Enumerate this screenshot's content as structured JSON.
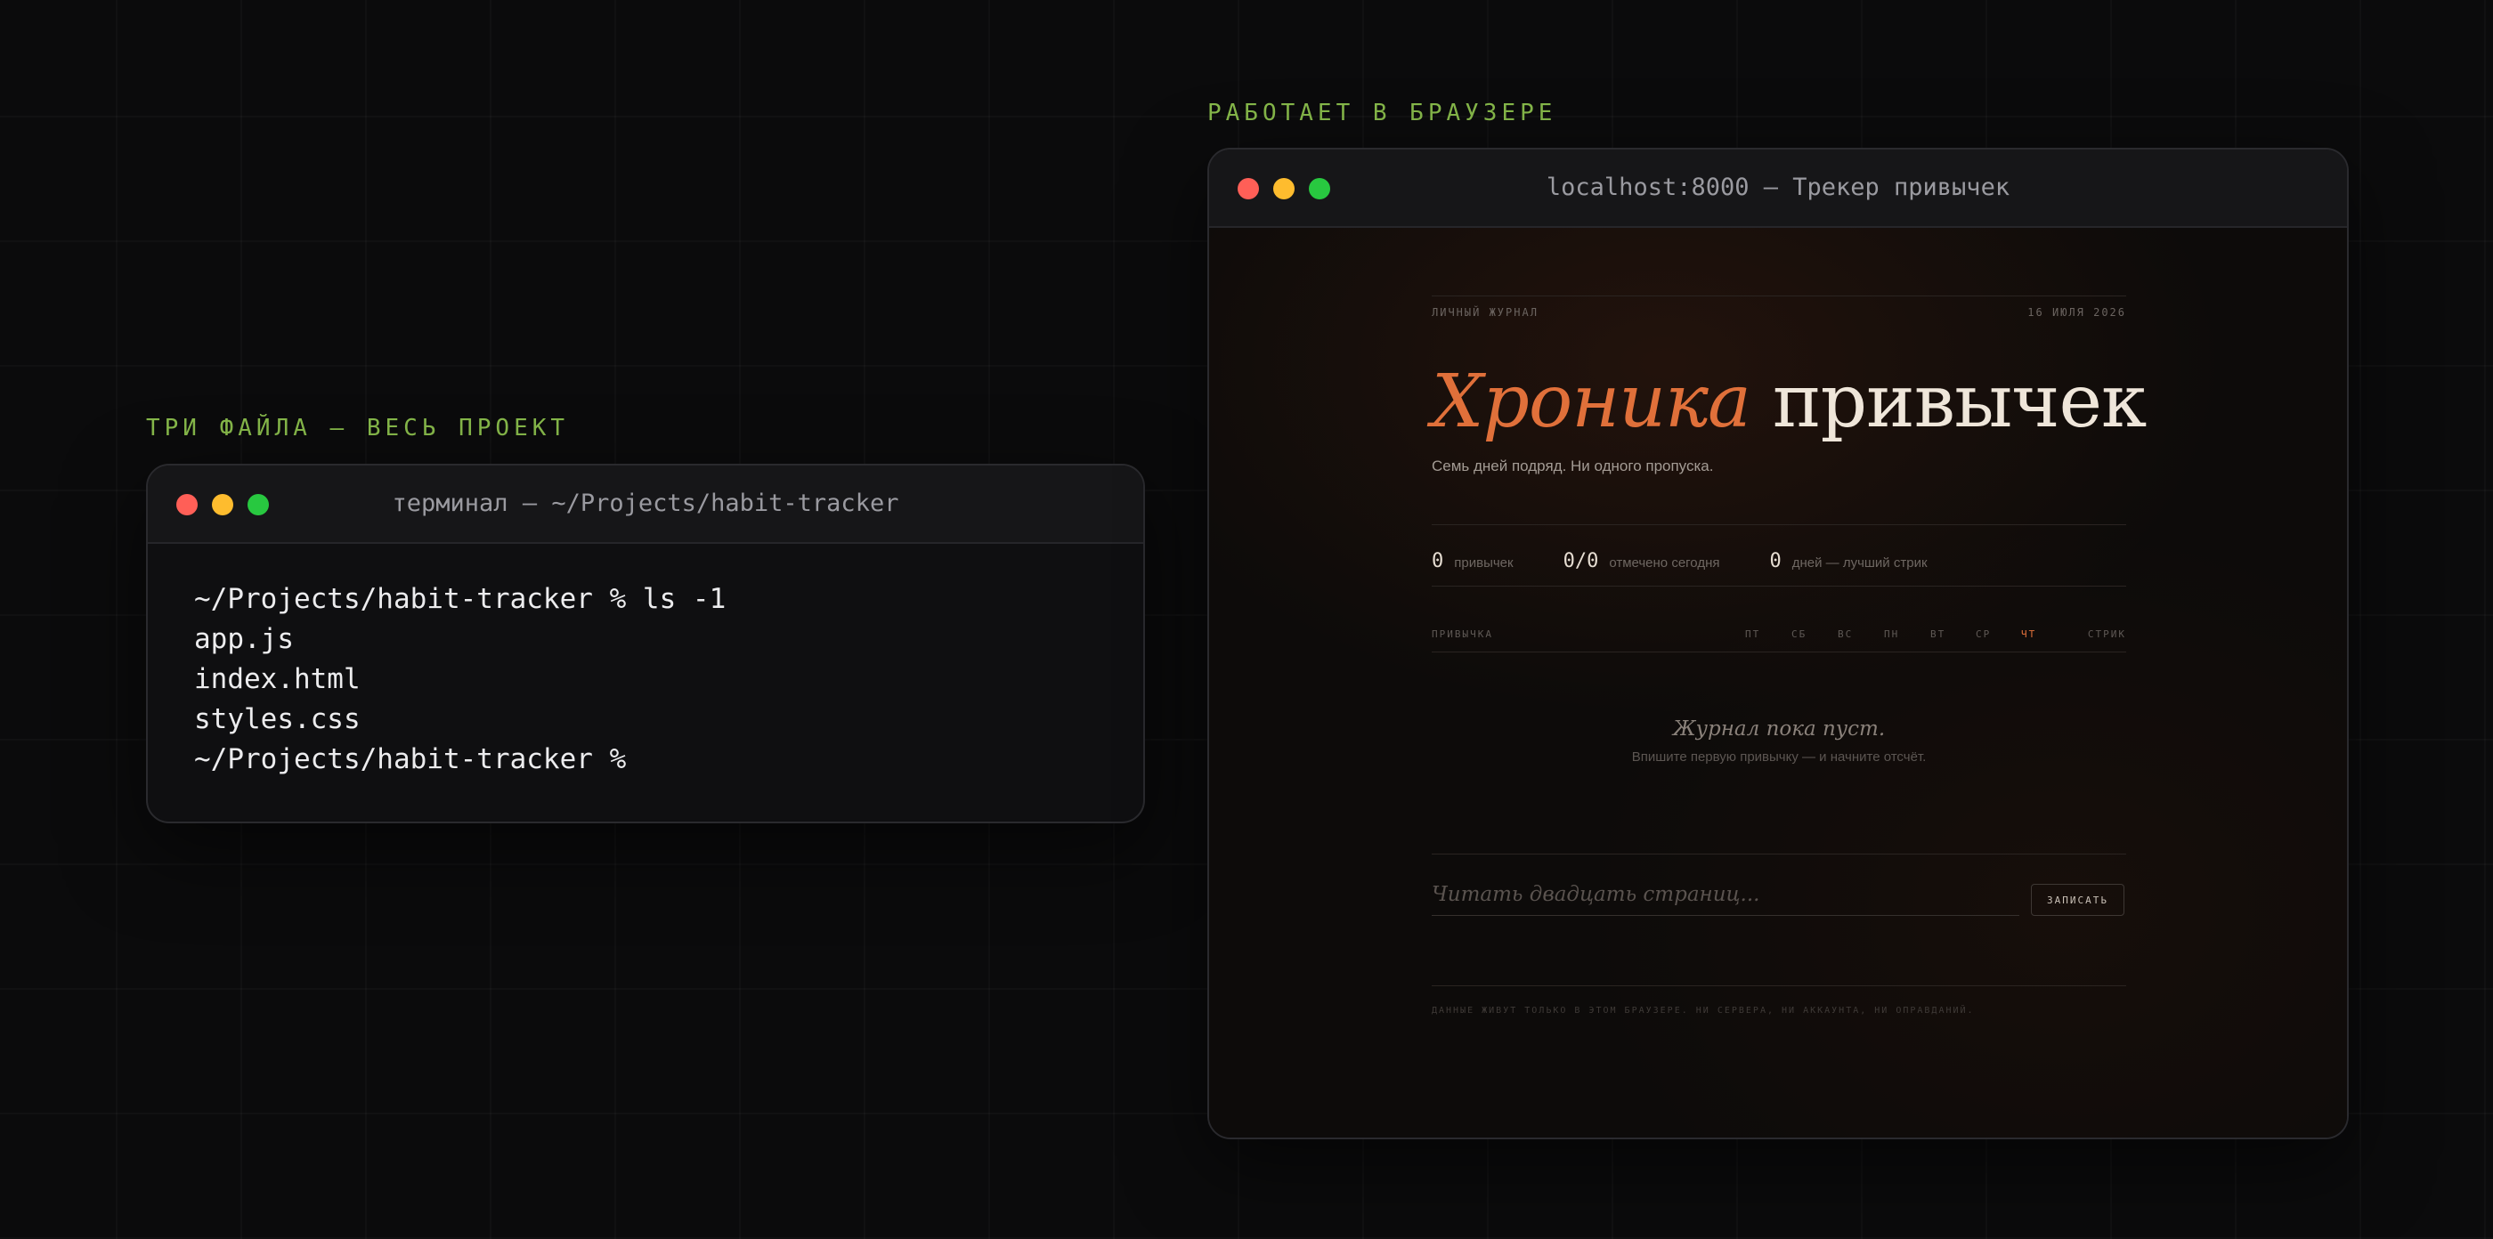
{
  "labels": {
    "left": "ТРИ ФАЙЛА — ВЕСЬ ПРОЕКТ",
    "right": "РАБОТАЕТ В БРАУЗЕРЕ"
  },
  "terminal": {
    "title": "терминал — ~/Projects/habit-tracker",
    "lines": [
      "~/Projects/habit-tracker % ls -1",
      "app.js",
      "index.html",
      "styles.css",
      "~/Projects/habit-tracker %"
    ]
  },
  "browser": {
    "title": "localhost:8000 — Трекер привычек"
  },
  "app": {
    "kicker": "ЛИЧНЫЙ ЖУРНАЛ",
    "date": "16 ИЮЛЯ 2026",
    "headline_accent": "Хроника",
    "headline_rest": "привычек",
    "subtitle": "Семь дней подряд. Ни одного пропуска.",
    "stats": [
      {
        "value": "0",
        "label": "привычек"
      },
      {
        "value": "0/0",
        "label": "отмечено сегодня"
      },
      {
        "value": "0",
        "label": "дней — лучший стрик"
      }
    ],
    "table": {
      "habit_header": "ПРИВЫЧКА",
      "days": [
        "ПТ",
        "СБ",
        "ВС",
        "ПН",
        "ВТ",
        "СР",
        "ЧТ"
      ],
      "streak_header": "СТРИК",
      "today_color": "#e0703a"
    },
    "empty": {
      "title": "Журнал пока пуст.",
      "subtitle": "Впишите первую привычку — и начните отсчёт."
    },
    "input": {
      "placeholder": "Читать двадцать страниц...",
      "value": ""
    },
    "add_button": "ЗАПИСАТЬ",
    "footer": "ДАННЫЕ ЖИВУТ ТОЛЬКО В ЭТОМ БРАУЗЕРЕ. НИ СЕРВЕРА, НИ АККАУНТА, НИ ОПРАВДАНИЙ."
  },
  "colors": {
    "accent_green": "#86b84a",
    "accent_orange": "#e0703a",
    "traffic_red": "#ff5f57",
    "traffic_yellow": "#febc2e",
    "traffic_green": "#28c840"
  }
}
